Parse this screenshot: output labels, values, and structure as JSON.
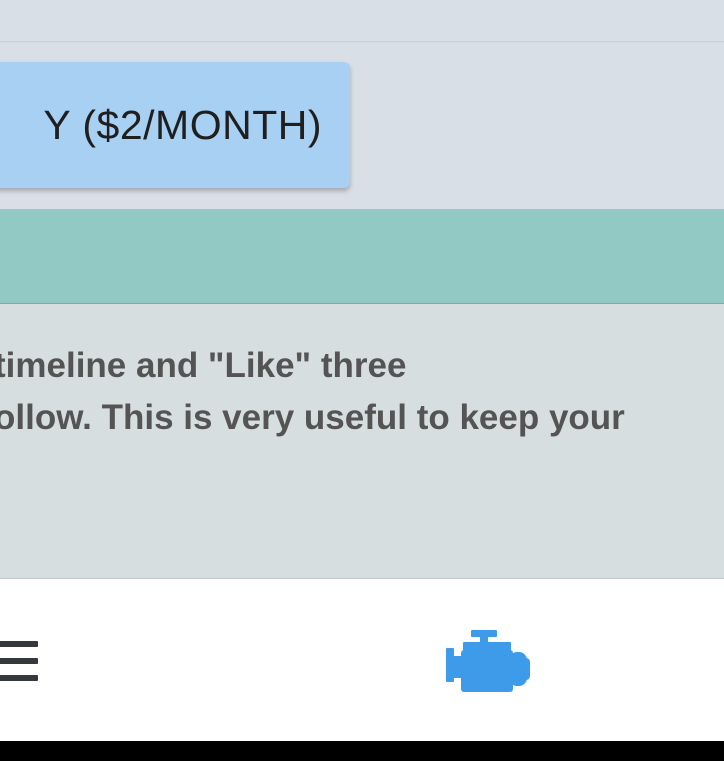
{
  "buy_button": {
    "label": "Y ($2/MONTH)"
  },
  "description": {
    "lines": [
      "timeline and \"Like\" three",
      "ollow. This is very useful to keep your"
    ]
  },
  "bottom_nav": {
    "menu_icon": "hamburger-menu-icon",
    "engine_icon": "engine-icon",
    "engine_color": "#3d9be9"
  },
  "colors": {
    "buy_button_bg": "#a8d0f2",
    "teal_bar": "#93c9c4",
    "card_bg": "#d7dedf",
    "page_bg": "#d9dfe6"
  }
}
